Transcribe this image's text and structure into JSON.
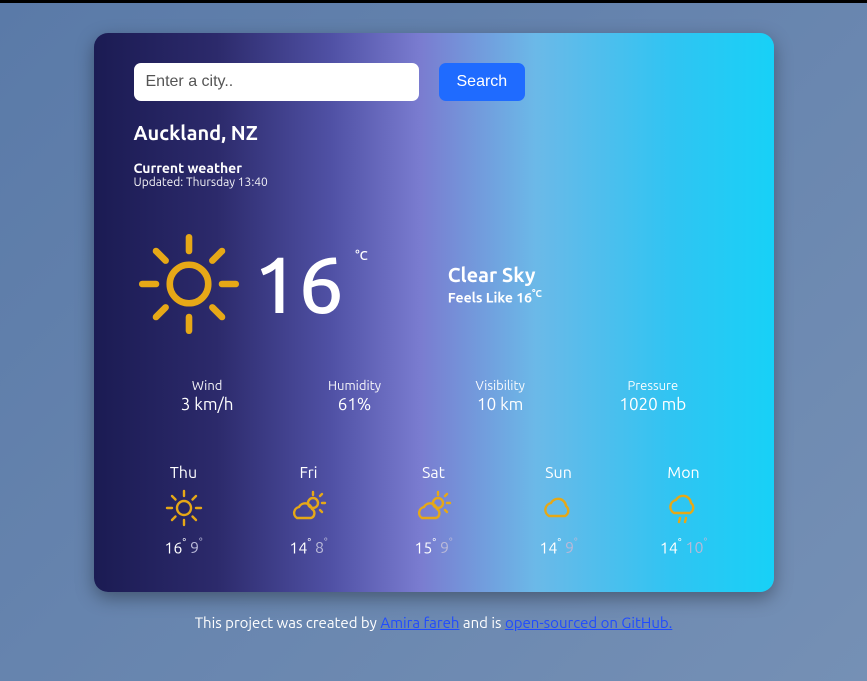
{
  "search": {
    "placeholder": "Enter a city..",
    "button": "Search"
  },
  "location": "Auckland, NZ",
  "current_label": "Current weather",
  "updated": "Updated: Thursday 13:40",
  "current": {
    "temp": "16",
    "unit": "°C",
    "description": "Clear Sky",
    "feels_prefix": "Feels Like ",
    "feels_temp": "16",
    "feels_unit": "°C",
    "icon": "sun"
  },
  "metrics": [
    {
      "label": "Wind",
      "value": "3 km/h"
    },
    {
      "label": "Humidity",
      "value": "61%"
    },
    {
      "label": "Visibility",
      "value": "10 km"
    },
    {
      "label": "Pressure",
      "value": "1020 mb"
    }
  ],
  "forecast": [
    {
      "day": "Thu",
      "icon": "sun",
      "hi": "16",
      "lo": "9"
    },
    {
      "day": "Fri",
      "icon": "partly",
      "hi": "14",
      "lo": "8"
    },
    {
      "day": "Sat",
      "icon": "partly",
      "hi": "15",
      "lo": "9"
    },
    {
      "day": "Sun",
      "icon": "cloud",
      "hi": "14",
      "lo": "9"
    },
    {
      "day": "Mon",
      "icon": "rain",
      "hi": "14",
      "lo": "10"
    }
  ],
  "footer": {
    "pre": "This project was created by ",
    "author": "Amira fareh",
    "mid": " and is ",
    "link": "open-sourced on GitHub."
  }
}
